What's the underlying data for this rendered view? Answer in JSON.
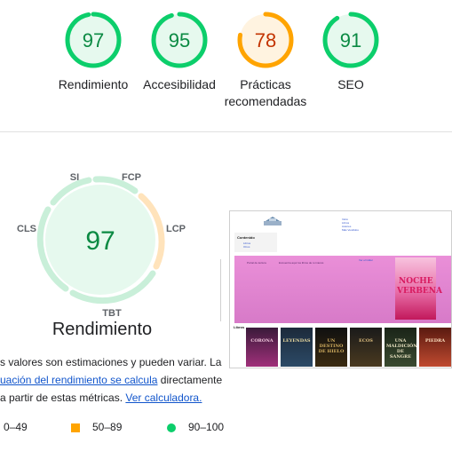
{
  "top_scores": [
    {
      "name": "Rendimiento",
      "value": "97",
      "fraction": 0.97,
      "color": "#0cce6b",
      "bg": "#e6f9ee",
      "text_color": "#0b8a43"
    },
    {
      "name": "Accesibilidad",
      "value": "95",
      "fraction": 0.95,
      "color": "#0cce6b",
      "bg": "#e6f9ee",
      "text_color": "#0b8a43"
    },
    {
      "name": "Prácticas recomendadas",
      "value": "78",
      "fraction": 0.78,
      "color": "#ffa400",
      "bg": "#fff3e0",
      "text_color": "#c33300"
    },
    {
      "name": "SEO",
      "value": "91",
      "fraction": 0.91,
      "color": "#0cce6b",
      "bg": "#e6f9ee",
      "text_color": "#0b8a43"
    }
  ],
  "performance": {
    "score": "97",
    "title": "Rendimiento",
    "metrics": [
      "SI",
      "FCP",
      "LCP",
      "TBT",
      "CLS"
    ]
  },
  "description": {
    "line1": "s valores son estimaciones y pueden variar. La",
    "line2_link": "uación del rendimiento se calcula",
    "line2_rest": " directamente",
    "line3_text": "a partir de estas métricas. ",
    "line3_link": "Ver calculadora."
  },
  "legend": {
    "fail": "0–49",
    "average": "50–89",
    "pass": "90–100"
  },
  "thumbnail": {
    "nav_items": [
      "Inicio",
      "Libros",
      "Autores",
      "Más Vendidos"
    ],
    "sidebar_title": "Contenido",
    "sidebar_items": [
      "Libros",
      "Otros"
    ],
    "banner_texts": [
      "Portal de lectura",
      "Encuentra aquí los libros de tu interés",
      "Ver el tráiler"
    ],
    "cover_big": [
      "NOCHE",
      "VERBENA"
    ],
    "books_label": "Libros",
    "books": [
      "CORONA",
      "LEYENDAS",
      "UN DESTINO DE HIELO",
      "ECOS",
      "UNA MALDICIÓN DE SANGRE",
      "PIEDRA"
    ]
  }
}
